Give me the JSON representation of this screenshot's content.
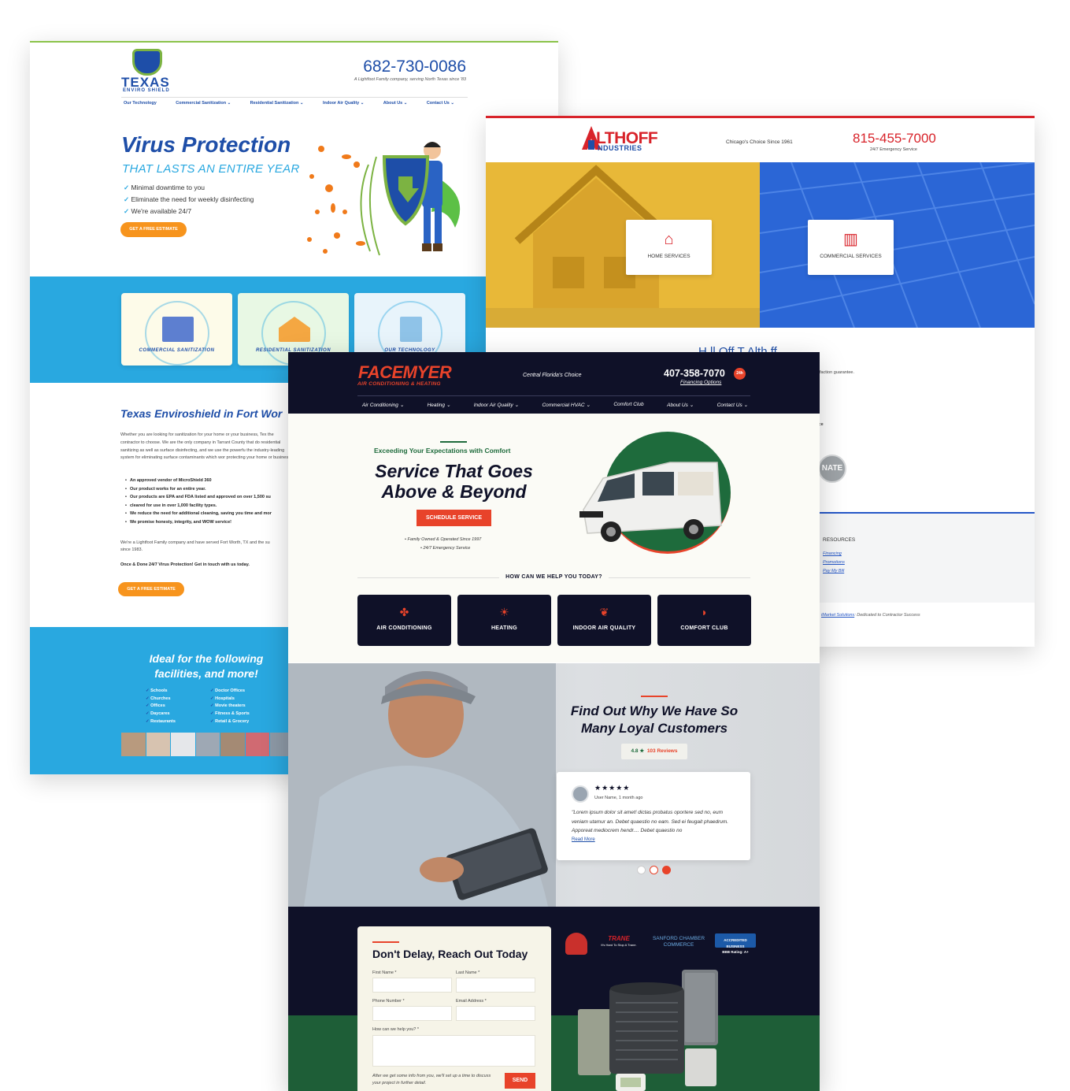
{
  "texas": {
    "logo": {
      "word": "TEXAS",
      "sub": "ENVIRO SHIELD"
    },
    "phone": "682-730-0086",
    "tagline": "A Lightfoot Family company, serving North Texas since '83",
    "nav": [
      "Our Technology",
      "Commercial Sanitization ⌄",
      "Residential Sanitization ⌄",
      "Indoor Air Quality ⌄",
      "About Us ⌄",
      "Contact Us ⌄"
    ],
    "hero": {
      "title": "Virus Protection",
      "subtitle": "THAT LASTS AN ENTIRE YEAR",
      "checks": [
        "Minimal downtime to you",
        "Eliminate the need for weekly disinfecting",
        "We're available 24/7"
      ],
      "cta": "GET A FREE ESTIMATE"
    },
    "cards": [
      "COMMERCIAL SANITIZATION",
      "RESIDENTIAL SANITIZATION",
      "OUR TECHNOLOGY"
    ],
    "section_title": "Texas Enviroshield in Fort Wor",
    "paragraph": "Whether you are looking for sanitization for your home or your business, Tex the contractor to choose. We are the only company in Tarrant County that do residential sanitizing as well as surface disinfecting, and we use the powerfu the industry-leading system for eliminating surface contaminants which wor protecting your home or business.",
    "bullets": [
      "An approved vendor of MicroShield 360",
      "Our product works for an entire year.",
      "Our products are EPA and FDA listed and approved on over 1,500 su",
      "cleared for use in over 1,000 facility types.",
      "We reduce the need for additional cleaning, saving you time and mor",
      "We promise honesty, integrity, and WOW service!"
    ],
    "paragraph2": [
      "We're a Lightfoot Family company and have served Fort Worth, TX and the su",
      "since 1983."
    ],
    "paragraph3": "Once & Done 24/7 Virus Protection! Get in touch with us today.",
    "cta2": "GET A FREE ESTIMATE",
    "ideal": "Ideal for the following facilities, and more!",
    "facilities_left": [
      "Schools",
      "Churches",
      "Offices",
      "Daycares",
      "Restaurants"
    ],
    "facilities_right": [
      "Doctor Offices",
      "Hospitals",
      "Movie theaters",
      "Fitness & Sports",
      "Retail & Grocery"
    ]
  },
  "althoff": {
    "logo": "LTHOFF",
    "logo_sub": "NDUSTRIES",
    "tagline": "Chicago's Choice Since 1961",
    "phone": "815-455-7000",
    "emergency": "24/7 Emergency Service",
    "home_label": "HOME SERVICES",
    "commercial_label": "COMMERCIAL SERVICES",
    "heading_fragment": "H    ll Off T   Alth ff",
    "text_fragment_1": "isfaction guarantee.",
    "text_fragment_2": "s.",
    "text_fragment_3": "ice",
    "nate": "NATE",
    "resources_title": "RESOURCES",
    "resources": [
      "Financing",
      "Promotions",
      "Pay My Bill"
    ],
    "credit_link": "iMarket Solutions",
    "credit_text": ": Dedicated to Contractor Success"
  },
  "facemyer": {
    "logo": "FACEMYER",
    "logo_sub": "AIR CONDITIONING & HEATING",
    "tagline": "Central Florida's Choice",
    "phone": "407-358-7070",
    "phone_badge": "24h",
    "financing": "Financing Options",
    "nav": [
      "Air Conditioning ⌄",
      "Heating ⌄",
      "Indoor Air Quality ⌄",
      "Commercial HVAC ⌄",
      "Comfort Club",
      "About Us ⌄",
      "Contact Us ⌄"
    ],
    "hero": {
      "eyebrow": "Exceeding Your Expectations with Comfort",
      "title": "Service That Goes Above & Beyond",
      "cta": "SCHEDULE SERVICE",
      "facts": [
        "• Family Owned & Operated Since 1997",
        "• 24/7 Emergency Service"
      ]
    },
    "help_title": "HOW CAN WE HELP YOU TODAY?",
    "services": [
      "AIR CONDITIONING",
      "HEATING",
      "INDOOR AIR QUALITY",
      "COMFORT CLUB"
    ],
    "reviews": {
      "title": "Find Out Why We Have So Many Loyal Customers",
      "score": "4.8 ★",
      "count": "103 Reviews",
      "stars": "★★★★★",
      "user": "User Name, 1 month ago",
      "quote": "\"Lorem ipsum dolor sit amet! dictas probatus oportere sed no, eum veniam utamur an. Debet quaestio no eam. Sed ei feugait phaedrum. Apporeat mediocrem hendr.... Debet quaestio no",
      "read_more": "Read More"
    },
    "form": {
      "title": "Don't Delay, Reach Out Today",
      "first": "First Name *",
      "last": "Last Name *",
      "phone": "Phone Number *",
      "email": "Email Address *",
      "help": "How can we help you? *",
      "note": "After we get some info from you, we'll set up a time to discuss your project in further detail.",
      "send": "SEND"
    },
    "badges": {
      "trane": "TRANE",
      "trane_tag": "It's Hard To Stop A Trane.",
      "chamber": "SANFORD CHAMBER COMMERCE",
      "bbb": "ACCREDITED BUSINESS",
      "bbb_rating": "BBB Rating: A+"
    }
  },
  "colors": {
    "texas_blue": "#1e4ea8",
    "texas_sky": "#29a8e0",
    "texas_orange": "#f7941d",
    "althoff_red": "#d8232a",
    "althoff_blue": "#2557c7",
    "facemyer_navy": "#0f1128",
    "facemyer_orange": "#e8432a",
    "facemyer_green": "#1e6b3c"
  }
}
